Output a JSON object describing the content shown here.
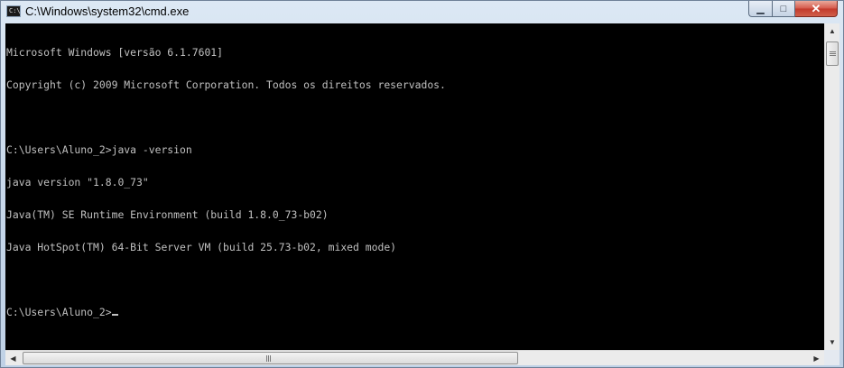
{
  "window": {
    "title": "C:\\Windows\\system32\\cmd.exe",
    "app_icon_text": "C:\\"
  },
  "caption_buttons": {
    "minimize": "▁",
    "maximize": "□",
    "close": "✕"
  },
  "console": {
    "lines": [
      "Microsoft Windows [versão 6.1.7601]",
      "Copyright (c) 2009 Microsoft Corporation. Todos os direitos reservados.",
      "",
      "C:\\Users\\Aluno_2>java -version",
      "java version \"1.8.0_73\"",
      "Java(TM) SE Runtime Environment (build 1.8.0_73-b02)",
      "Java HotSpot(TM) 64-Bit Server VM (build 25.73-b02, mixed mode)",
      "",
      "C:\\Users\\Aluno_2>"
    ],
    "colors": {
      "background": "#000000",
      "text": "#c0c0c0"
    }
  },
  "scrollbars": {
    "up_arrow": "▲",
    "down_arrow": "▼",
    "left_arrow": "◀",
    "right_arrow": "▶"
  }
}
